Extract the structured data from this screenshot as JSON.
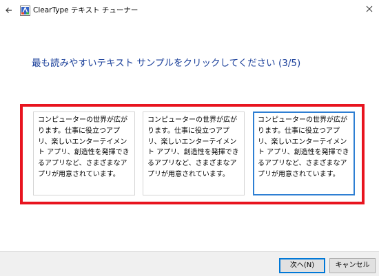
{
  "window": {
    "title": "ClearType テキスト チューナー",
    "back_icon": "back-arrow-icon",
    "close_icon": "close-icon",
    "app_icon": "cleartype-app-icon"
  },
  "main": {
    "heading": "最も読みやすいテキスト サンプルをクリックしてください (3/5)",
    "samples": [
      {
        "text": "コンピューターの世界が広がります。仕事に役立つアプリ、楽しいエンターテイメント アプリ、創造性を発揮できるアプリなど、さまざまなアプリが用意されています。",
        "selected": false
      },
      {
        "text": "コンピューターの世界が広がります。仕事に役立つアプリ、楽しいエンターテイメント アプリ、創造性を発揮できるアプリなど、さまざまなアプリが用意されています。",
        "selected": false
      },
      {
        "text": "コンピューターの世界が広がります。仕事に役立つアプリ、楽しいエンターテイメント アプリ、創造性を発揮できるアプリなど、さまざまなアプリが用意されています。",
        "selected": true
      }
    ]
  },
  "footer": {
    "next_label": "次へ(N)",
    "cancel_label": "キャンセル"
  },
  "colors": {
    "heading": "#1a3f9a",
    "highlight_border": "#e8141f",
    "selected_border": "#2e7fd3",
    "footer_bg": "#f0f0f0"
  }
}
